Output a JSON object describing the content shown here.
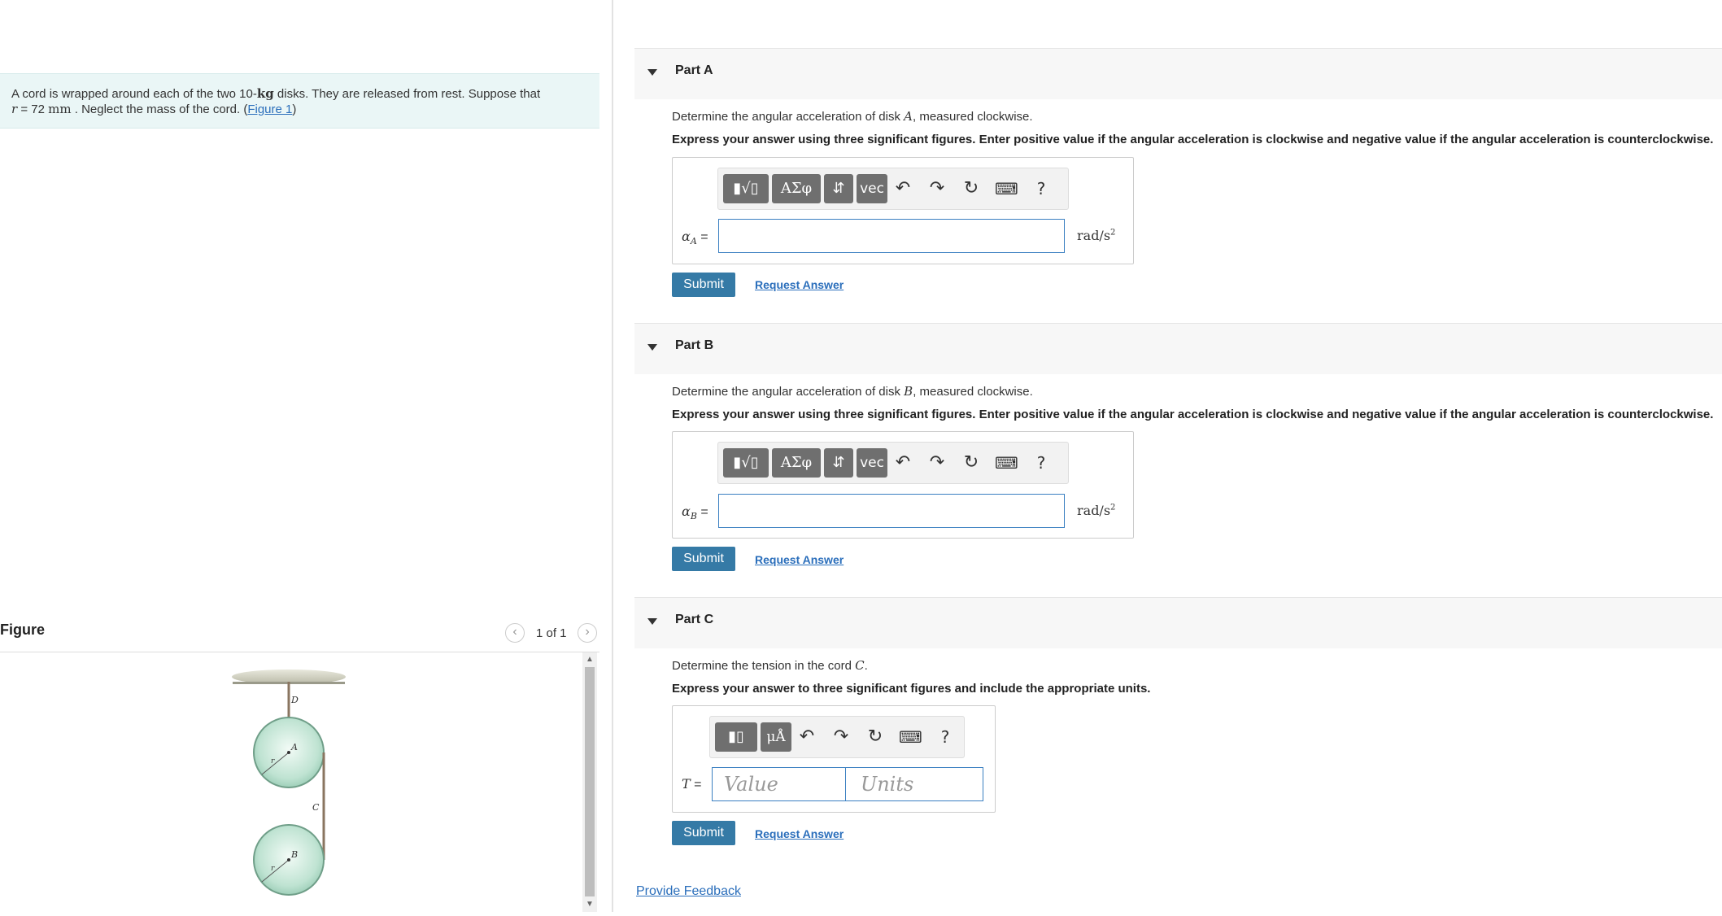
{
  "problem": {
    "t1": "A cord is wrapped around each of the two 10-",
    "kg": "kg",
    "t2": " disks. They are released from rest. Suppose that",
    "r_var": "r",
    "t3": " = 72 ",
    "mm": "mm",
    "t4": " . Neglect the mass of the cord. (",
    "fig_link": "Figure 1",
    "t5": ")"
  },
  "figure": {
    "title": "Figure",
    "count": "1 of 1",
    "labels": {
      "D": "D",
      "A": "A",
      "B": "B",
      "C": "C",
      "r": "r"
    }
  },
  "toolbar_full": {
    "templates": "▮√▯",
    "greek": "ΑΣφ",
    "arrows": "⇵",
    "vec": "vec",
    "help": "?"
  },
  "toolbar_units": {
    "templates": "▮▯",
    "units": "μÅ",
    "help": "?"
  },
  "parts": [
    {
      "title": "Part A",
      "q1": "Determine the angular acceleration of disk ",
      "qvar": "A",
      "q2": ", measured clockwise.",
      "instructions": "Express your answer using three significant figures. Enter positive value if the angular acceleration is clockwise and negative value if the angular acceleration is counterclockwise.",
      "var": "α",
      "sub": "A",
      "eq": " =",
      "unit": "rad/s",
      "unit_exp": "2",
      "submit": "Submit",
      "request": "Request Answer"
    },
    {
      "title": "Part B",
      "q1": "Determine the angular acceleration of disk ",
      "qvar": "B",
      "q2": ", measured clockwise.",
      "instructions": "Express your answer using three significant figures. Enter positive value if the angular acceleration is clockwise and negative value if the angular acceleration is counterclockwise.",
      "var": "α",
      "sub": "B",
      "eq": " =",
      "unit": "rad/s",
      "unit_exp": "2",
      "submit": "Submit",
      "request": "Request Answer"
    },
    {
      "title": "Part C",
      "q1": "Determine the tension in the cord ",
      "qvar": "C",
      "q2": ".",
      "instructions": "Express your answer to three significant figures and include the appropriate units.",
      "var": "T",
      "eq": " =",
      "value_placeholder": "Value",
      "units_placeholder": "Units",
      "submit": "Submit",
      "request": "Request Answer"
    }
  ],
  "feedback": "Provide Feedback"
}
